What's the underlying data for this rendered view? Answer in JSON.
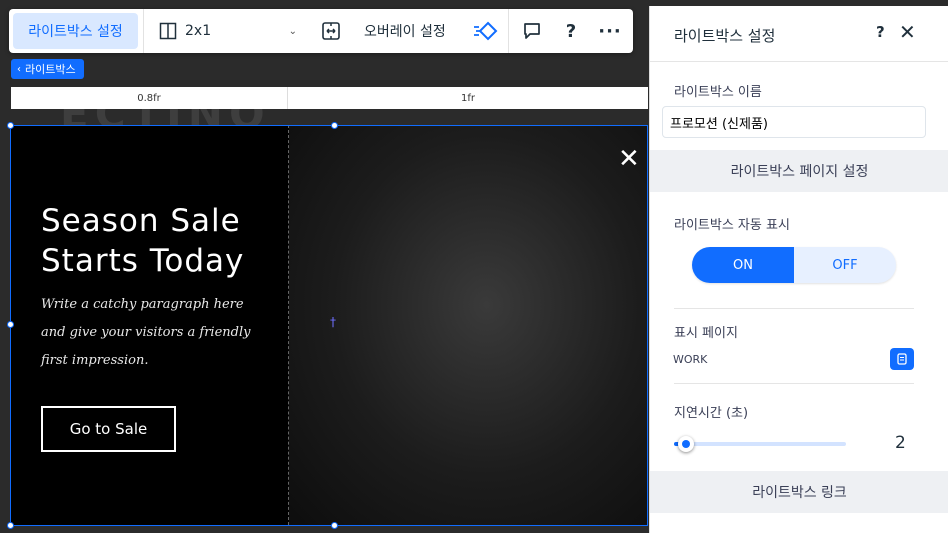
{
  "toolbar": {
    "main_button": "라이트박스 설정",
    "layout_value": "2x1",
    "overlay_button": "오버레이 설정"
  },
  "breadcrumb": {
    "label": "라이트박스"
  },
  "grid": {
    "columns": [
      "0.8fr",
      "1fr"
    ]
  },
  "lightbox": {
    "headline_line1": "Season Sale",
    "headline_line2": "Starts Today",
    "paragraph": "Write a catchy paragraph here and give your visitors a friendly first impression.",
    "button_label": "Go to Sale"
  },
  "panel": {
    "title": "라이트박스 설정",
    "name_label": "라이트박스 이름",
    "name_value": "프로모션 (신제품)",
    "page_settings_header": "라이트박스 페이지 설정",
    "auto_display_label": "라이트박스 자동 표시",
    "toggle_on": "ON",
    "toggle_off": "OFF",
    "toggle_state": "ON",
    "display_page_label": "표시 페이지",
    "display_page_value": "WORK",
    "delay_label": "지연시간 (초)",
    "delay_value": "2",
    "delay_fraction": 0.0,
    "link_header": "라이트박스 링크"
  },
  "colors": {
    "accent": "#116dff",
    "accent_light": "#d9e8ff",
    "section_bg": "#eef0f3",
    "canvas_bg": "#000000"
  },
  "icons": {
    "layout": "columns-layout-icon",
    "fit": "fit-to-screen-icon",
    "animation": "animation-icon",
    "comment": "comment-icon",
    "help": "help-icon",
    "more": "more-icon",
    "close": "close-icon",
    "page": "page-icon"
  }
}
